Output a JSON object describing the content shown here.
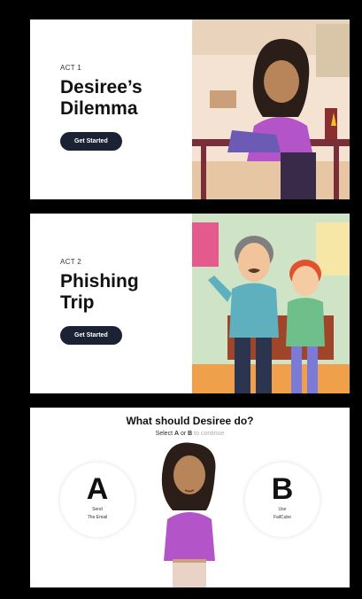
{
  "acts": [
    {
      "label": "ACT 1",
      "title_line1": "Desiree’s",
      "title_line2": "Dilemma",
      "button": "Get Started"
    },
    {
      "label": "ACT 2",
      "title_line1": "Phishing",
      "title_line2": "Trip",
      "button": "Get Started"
    }
  ],
  "choice": {
    "question": "What should Desiree do?",
    "sub_prefix": "Select ",
    "sub_a": "A",
    "sub_or": " or ",
    "sub_b": "B",
    "sub_suffix": " to continue",
    "a": {
      "letter": "A",
      "line1": "Send",
      "line2": "The Email"
    },
    "b": {
      "letter": "B",
      "line1": "Use",
      "line2": "FailCube"
    }
  }
}
